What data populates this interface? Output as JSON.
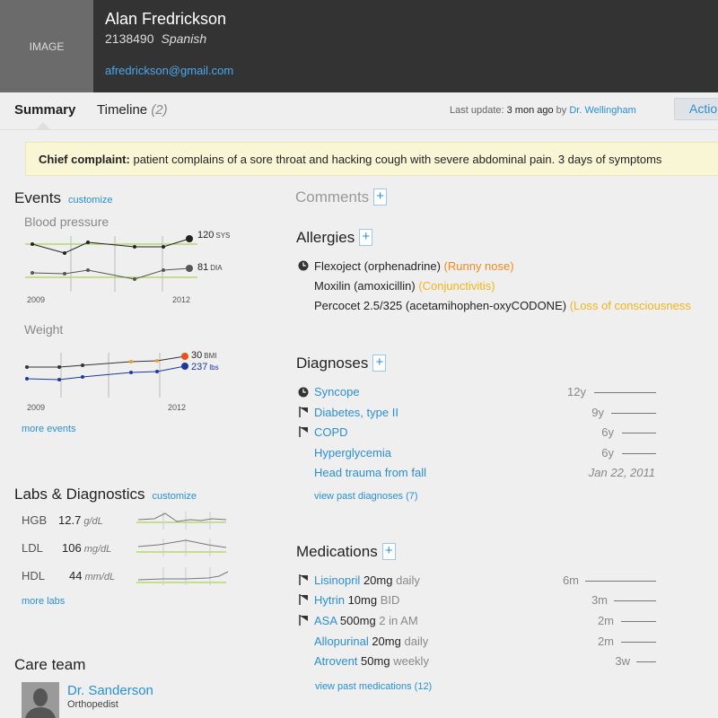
{
  "patient": {
    "photo_placeholder": "IMAGE",
    "name": "Alan Fredrickson",
    "id": "2138490",
    "language": "Spanish",
    "email": "afredrickson@gmail.com"
  },
  "tabs": {
    "summary": "Summary",
    "timeline": "Timeline",
    "timeline_count": "(2)"
  },
  "update": {
    "label": "Last update:",
    "when": "3 mon ago",
    "by": "by",
    "doctor": "Dr. Wellingham"
  },
  "actions_label": "Actio",
  "complaint": {
    "label": "Chief complaint:",
    "text": "patient complains of a sore throat and hacking cough with severe abdominal pain. 3 days of symptoms"
  },
  "events": {
    "title": "Events",
    "customize": "customize",
    "bp": {
      "title": "Blood pressure",
      "sys_value": "120",
      "sys_unit": "SYS",
      "dia_value": "81",
      "dia_unit": "DIA",
      "x_start": "2009",
      "x_end": "2012"
    },
    "weight": {
      "title": "Weight",
      "bmi_value": "30",
      "bmi_unit": "BMI",
      "lbs_value": "237",
      "lbs_unit": "lbs",
      "x_start": "2009",
      "x_end": "2012"
    },
    "more": "more events"
  },
  "labs": {
    "title": "Labs & Diagnostics",
    "customize": "customize",
    "rows": [
      {
        "name": "HGB",
        "value": "12.7",
        "unit": "g/dL"
      },
      {
        "name": "LDL",
        "value": "106",
        "unit": "mg/dL"
      },
      {
        "name": "HDL",
        "value": "44",
        "unit": "mm/dL"
      }
    ],
    "more": "more labs"
  },
  "care_team": {
    "title": "Care team",
    "members": [
      {
        "name": "Dr. Sanderson",
        "role": "Orthopedist"
      }
    ]
  },
  "comments": {
    "title": "Comments",
    "add": "+"
  },
  "allergies": {
    "title": "Allergies",
    "add": "+",
    "items": [
      {
        "drug": "Flexoject (orphenadrine)",
        "reaction": "(Runny nose)"
      },
      {
        "drug": "Moxilin (amoxicillin)",
        "reaction": "(Conjunctivitis)"
      },
      {
        "drug": "Percocet 2.5/325 (acetamihophen-oxyCODONE)",
        "reaction": "(Loss of consciousness"
      }
    ]
  },
  "diagnoses": {
    "title": "Diagnoses",
    "add": "+",
    "items": [
      {
        "name": "Syncope",
        "age": "12y"
      },
      {
        "name": "Diabetes, type II",
        "age": "9y"
      },
      {
        "name": "COPD",
        "age": "6y"
      },
      {
        "name": "Hyperglycemia",
        "age": "6y"
      },
      {
        "name": "Head trauma from fall",
        "age": "Jan 22, 2011"
      }
    ],
    "view_past": "view past diagnoses (7)"
  },
  "medications": {
    "title": "Medications",
    "add": "+",
    "items": [
      {
        "name": "Lisinopril",
        "dose": "20mg",
        "freq": "daily",
        "age": "6m"
      },
      {
        "name": "Hytrin",
        "dose": "10mg",
        "freq": "BID",
        "age": "3m"
      },
      {
        "name": "ASA",
        "dose": "500mg",
        "freq": "2 in AM",
        "age": "2m"
      },
      {
        "name": "Allopurinal",
        "dose": "20mg",
        "freq": "daily",
        "age": "2m"
      },
      {
        "name": "Atrovent",
        "dose": "50mg",
        "freq": "weekly",
        "age": "3w"
      }
    ],
    "view_past": "view past medications (12)"
  },
  "colors": {
    "link": "#2a8fd4",
    "header_bg": "#333333",
    "target_line": "#9acd32",
    "bmi_marker": "#e8501e",
    "weight_series": "#1a3a9e",
    "reaction_orange": "#f08a1e",
    "reaction_yellow": "#f2b41b",
    "complaint_bg": "#f9f6d6"
  },
  "icons": {
    "clock": "clock-icon",
    "flag": "flag-icon"
  }
}
